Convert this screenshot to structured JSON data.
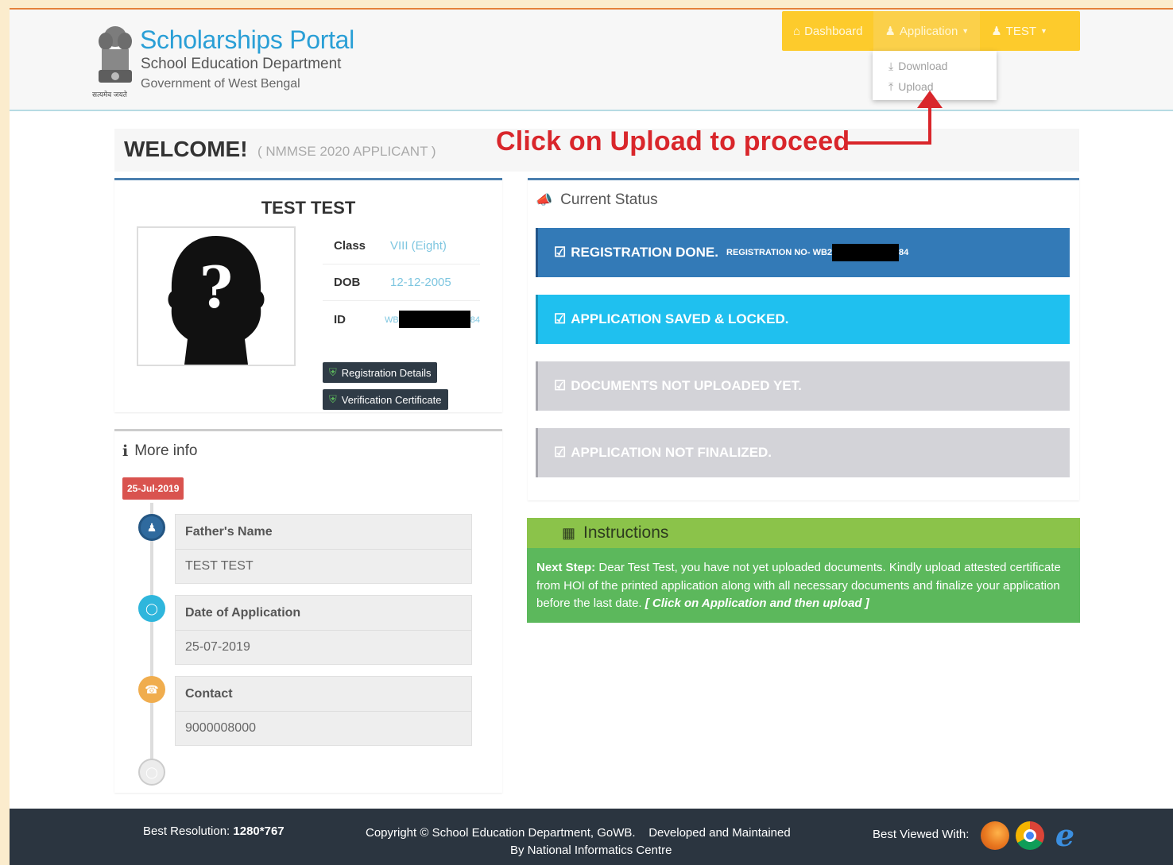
{
  "header": {
    "title": "Scholarships Portal",
    "subtitle": "School Education Department",
    "government": "Government of West Bengal",
    "emblem_caption": "सत्यमेव जयते"
  },
  "nav": {
    "dashboard": "Dashboard",
    "application": "Application",
    "user": "TEST",
    "dropdown": {
      "download": "Download",
      "upload": "Upload"
    }
  },
  "welcome": {
    "title": "WELCOME!",
    "subtitle": "( NMMSE 2020 APPLICANT )"
  },
  "annotation": "Click on Upload to proceed",
  "profile": {
    "name": "TEST TEST",
    "class_label": "Class",
    "class_value": "VIII (Eight)",
    "dob_label": "DOB",
    "dob_value": "12-12-2005",
    "id_label": "ID",
    "id_prefix": "WB",
    "id_suffix": "84",
    "buttons": {
      "registration_details": "Registration Details",
      "verification_certificate": "Verification Certificate"
    }
  },
  "more_info": {
    "title": "More info",
    "date_badge": "25-Jul-2019",
    "items": [
      {
        "title": "Father's Name",
        "value": "TEST TEST"
      },
      {
        "title": "Date of Application",
        "value": "25-07-2019"
      },
      {
        "title": "Contact",
        "value": "9000008000"
      }
    ]
  },
  "status": {
    "title": "Current Status",
    "items": [
      {
        "label": "REGISTRATION DONE.",
        "extra": "REGISTRATION NO- WB2",
        "extra_suffix": "84",
        "color": "#337ab7"
      },
      {
        "label": "APPLICATION SAVED & LOCKED.",
        "color": "#1fc0ef"
      },
      {
        "label": "DOCUMENTS NOT UPLOADED YET.",
        "color": "#d3d3d8"
      },
      {
        "label": "APPLICATION NOT FINALIZED.",
        "color": "#d3d3d8"
      }
    ]
  },
  "instructions": {
    "title": "Instructions",
    "lead": "Next Step:",
    "body": "Dear Test Test, you have not yet uploaded documents. Kindly upload attested certificate from HOI of the printed application along with all necessary documents and finalize your application before the last date.",
    "hint": "[ Click on Application and then upload ]"
  },
  "footer": {
    "resolution_label": "Best Resolution:",
    "resolution_value": "1280*767",
    "copyright": "Copyright © School Education Department, GoWB.",
    "developed": "Developed and Maintained",
    "nic": "By National Informatics Centre",
    "best_viewed": "Best Viewed With:"
  },
  "colors": {
    "nav": "#fdcb2c",
    "accent": "#2a9fd6",
    "annotation": "#d9262b",
    "footer": "#2b3540"
  }
}
